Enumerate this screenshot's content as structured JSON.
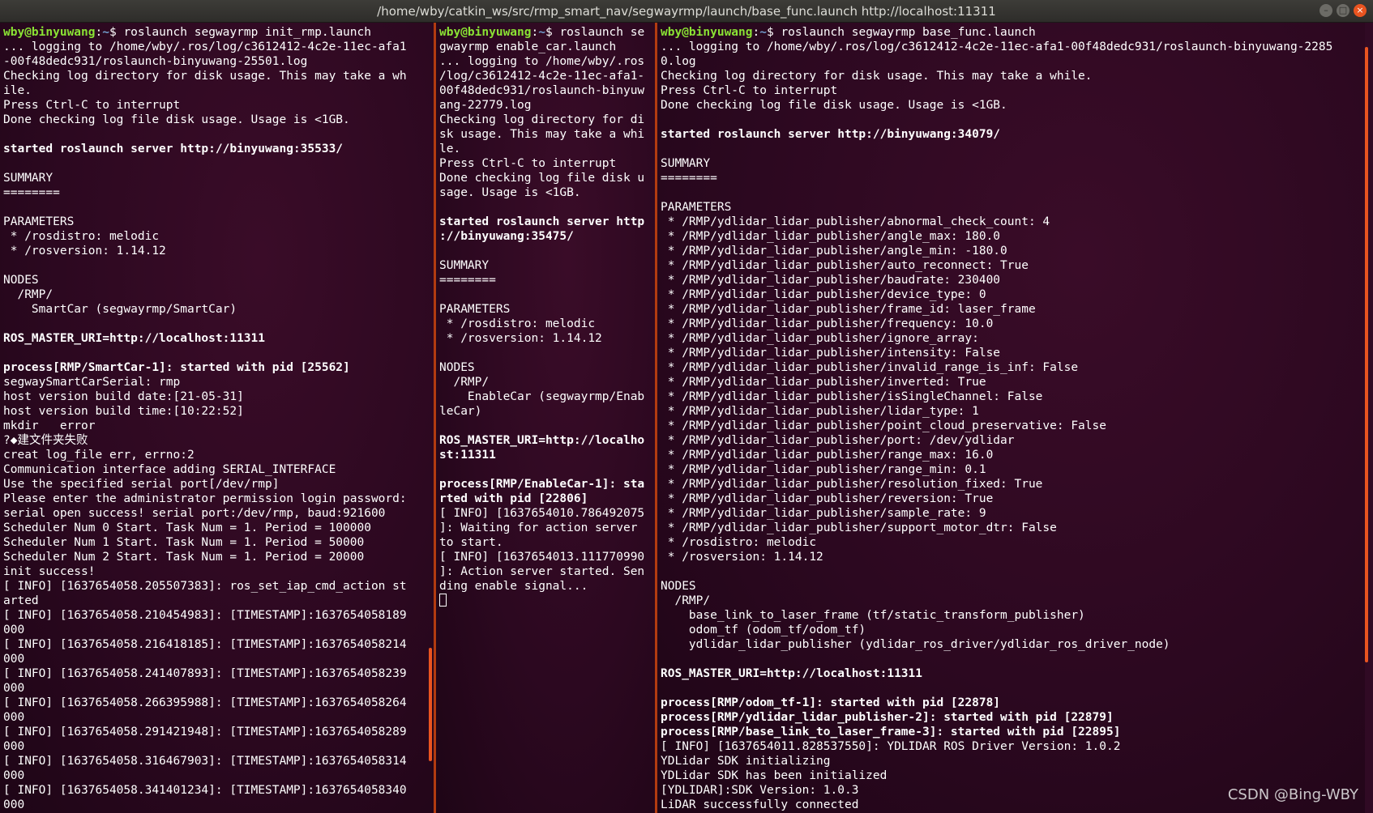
{
  "window": {
    "title": "/home/wby/catkin_ws/src/rmp_smart_nav/segwayrmp/launch/base_func.launch http://localhost:11311",
    "controls": [
      "–",
      "□",
      "×"
    ]
  },
  "colors": {
    "background": "#300a24",
    "prompt_user": "#8ae234",
    "prompt_path": "#729fcf",
    "separator": "#b23b10",
    "scrollbar": "#e95420"
  },
  "watermark": "CSDN @Bing-WBY",
  "panes": {
    "left": {
      "prompt": {
        "user": "wby@binyuwang",
        "sep": ":",
        "path": "~",
        "sym": "$ ",
        "cmd": "roslaunch segwayrmp init_rmp.launch"
      },
      "lines": [
        {
          "t": "... logging to /home/wby/.ros/log/c3612412-4c2e-11ec-afa1"
        },
        {
          "t": "-00f48dedc931/roslaunch-binyuwang-25501.log"
        },
        {
          "t": "Checking log directory for disk usage. This may take a wh"
        },
        {
          "t": "ile."
        },
        {
          "t": "Press Ctrl-C to interrupt"
        },
        {
          "t": "Done checking log file disk usage. Usage is <1GB."
        },
        {
          "t": ""
        },
        {
          "t": "started roslaunch server http://binyuwang:35533/",
          "b": true
        },
        {
          "t": ""
        },
        {
          "t": "SUMMARY"
        },
        {
          "t": "========"
        },
        {
          "t": ""
        },
        {
          "t": "PARAMETERS"
        },
        {
          "t": " * /rosdistro: melodic"
        },
        {
          "t": " * /rosversion: 1.14.12"
        },
        {
          "t": ""
        },
        {
          "t": "NODES"
        },
        {
          "t": "  /RMP/"
        },
        {
          "t": "    SmartCar (segwayrmp/SmartCar)"
        },
        {
          "t": ""
        },
        {
          "t": "ROS_MASTER_URI=http://localhost:11311",
          "b": true
        },
        {
          "t": ""
        },
        {
          "t": "process[RMP/SmartCar-1]: started with pid [25562]",
          "b": true
        },
        {
          "t": "segwaySmartCarSerial: rmp"
        },
        {
          "t": "host version build date:[21-05-31]"
        },
        {
          "t": "host version build time:[10:22:52]"
        },
        {
          "t": "mkdir   error"
        },
        {
          "t": "?◆建文件夹失败"
        },
        {
          "t": "creat log_file err, errno:2"
        },
        {
          "t": "Communication interface adding SERIAL_INTERFACE"
        },
        {
          "t": "Use the specified serial port[/dev/rmp]"
        },
        {
          "t": "Please enter the administrator permission login password:"
        },
        {
          "t": "serial open success! serial port:/dev/rmp, baud:921600"
        },
        {
          "t": "Scheduler Num 0 Start. Task Num = 1. Period = 100000"
        },
        {
          "t": "Scheduler Num 1 Start. Task Num = 1. Period = 50000"
        },
        {
          "t": "Scheduler Num 2 Start. Task Num = 1. Period = 20000"
        },
        {
          "t": "init success!"
        },
        {
          "t": "[ INFO] [1637654058.205507383]: ros_set_iap_cmd_action st"
        },
        {
          "t": "arted"
        },
        {
          "t": "[ INFO] [1637654058.210454983]: [TIMESTAMP]:1637654058189"
        },
        {
          "t": "000"
        },
        {
          "t": "[ INFO] [1637654058.216418185]: [TIMESTAMP]:1637654058214"
        },
        {
          "t": "000"
        },
        {
          "t": "[ INFO] [1637654058.241407893]: [TIMESTAMP]:1637654058239"
        },
        {
          "t": "000"
        },
        {
          "t": "[ INFO] [1637654058.266395988]: [TIMESTAMP]:1637654058264"
        },
        {
          "t": "000"
        },
        {
          "t": "[ INFO] [1637654058.291421948]: [TIMESTAMP]:1637654058289"
        },
        {
          "t": "000"
        },
        {
          "t": "[ INFO] [1637654058.316467903]: [TIMESTAMP]:1637654058314"
        },
        {
          "t": "000"
        },
        {
          "t": "[ INFO] [1637654058.341401234]: [TIMESTAMP]:1637654058340"
        },
        {
          "t": "000"
        }
      ]
    },
    "middle": {
      "prompt": {
        "user": "wby@binyuwang",
        "sep": ":",
        "path": "~",
        "sym": "$ ",
        "cmd": "roslaunch se"
      },
      "lines": [
        {
          "t": "gwayrmp enable_car.launch"
        },
        {
          "t": "... logging to /home/wby/.ros"
        },
        {
          "t": "/log/c3612412-4c2e-11ec-afa1-"
        },
        {
          "t": "00f48dedc931/roslaunch-binyuw"
        },
        {
          "t": "ang-22779.log"
        },
        {
          "t": "Checking log directory for di"
        },
        {
          "t": "sk usage. This may take a whi"
        },
        {
          "t": "le."
        },
        {
          "t": "Press Ctrl-C to interrupt"
        },
        {
          "t": "Done checking log file disk u"
        },
        {
          "t": "sage. Usage is <1GB."
        },
        {
          "t": ""
        },
        {
          "t": "started roslaunch server http",
          "b": true
        },
        {
          "t": "://binyuwang:35475/",
          "b": true
        },
        {
          "t": ""
        },
        {
          "t": "SUMMARY"
        },
        {
          "t": "========"
        },
        {
          "t": ""
        },
        {
          "t": "PARAMETERS"
        },
        {
          "t": " * /rosdistro: melodic"
        },
        {
          "t": " * /rosversion: 1.14.12"
        },
        {
          "t": ""
        },
        {
          "t": "NODES"
        },
        {
          "t": "  /RMP/"
        },
        {
          "t": "    EnableCar (segwayrmp/Enab"
        },
        {
          "t": "leCar)"
        },
        {
          "t": ""
        },
        {
          "t": "ROS_MASTER_URI=http://localho",
          "b": true
        },
        {
          "t": "st:11311",
          "b": true
        },
        {
          "t": ""
        },
        {
          "t": "process[RMP/EnableCar-1]: sta",
          "b": true
        },
        {
          "t": "rted with pid [22806]",
          "b": true
        },
        {
          "t": "[ INFO] [1637654010.786492075"
        },
        {
          "t": "]: Waiting for action server"
        },
        {
          "t": "to start."
        },
        {
          "t": "[ INFO] [1637654013.111770990"
        },
        {
          "t": "]: Action server started. Sen"
        },
        {
          "t": "ding enable signal..."
        }
      ]
    },
    "right": {
      "prompt": {
        "user": "wby@binyuwang",
        "sep": ":",
        "path": "~",
        "sym": "$ ",
        "cmd": "roslaunch segwayrmp base_func.launch"
      },
      "lines": [
        {
          "t": "... logging to /home/wby/.ros/log/c3612412-4c2e-11ec-afa1-00f48dedc931/roslaunch-binyuwang-2285"
        },
        {
          "t": "0.log"
        },
        {
          "t": "Checking log directory for disk usage. This may take a while."
        },
        {
          "t": "Press Ctrl-C to interrupt"
        },
        {
          "t": "Done checking log file disk usage. Usage is <1GB."
        },
        {
          "t": ""
        },
        {
          "t": "started roslaunch server http://binyuwang:34079/",
          "b": true
        },
        {
          "t": ""
        },
        {
          "t": "SUMMARY"
        },
        {
          "t": "========"
        },
        {
          "t": ""
        },
        {
          "t": "PARAMETERS"
        },
        {
          "t": " * /RMP/ydlidar_lidar_publisher/abnormal_check_count: 4"
        },
        {
          "t": " * /RMP/ydlidar_lidar_publisher/angle_max: 180.0"
        },
        {
          "t": " * /RMP/ydlidar_lidar_publisher/angle_min: -180.0"
        },
        {
          "t": " * /RMP/ydlidar_lidar_publisher/auto_reconnect: True"
        },
        {
          "t": " * /RMP/ydlidar_lidar_publisher/baudrate: 230400"
        },
        {
          "t": " * /RMP/ydlidar_lidar_publisher/device_type: 0"
        },
        {
          "t": " * /RMP/ydlidar_lidar_publisher/frame_id: laser_frame"
        },
        {
          "t": " * /RMP/ydlidar_lidar_publisher/frequency: 10.0"
        },
        {
          "t": " * /RMP/ydlidar_lidar_publisher/ignore_array:"
        },
        {
          "t": " * /RMP/ydlidar_lidar_publisher/intensity: False"
        },
        {
          "t": " * /RMP/ydlidar_lidar_publisher/invalid_range_is_inf: False"
        },
        {
          "t": " * /RMP/ydlidar_lidar_publisher/inverted: True"
        },
        {
          "t": " * /RMP/ydlidar_lidar_publisher/isSingleChannel: False"
        },
        {
          "t": " * /RMP/ydlidar_lidar_publisher/lidar_type: 1"
        },
        {
          "t": " * /RMP/ydlidar_lidar_publisher/point_cloud_preservative: False"
        },
        {
          "t": " * /RMP/ydlidar_lidar_publisher/port: /dev/ydlidar"
        },
        {
          "t": " * /RMP/ydlidar_lidar_publisher/range_max: 16.0"
        },
        {
          "t": " * /RMP/ydlidar_lidar_publisher/range_min: 0.1"
        },
        {
          "t": " * /RMP/ydlidar_lidar_publisher/resolution_fixed: True"
        },
        {
          "t": " * /RMP/ydlidar_lidar_publisher/reversion: True"
        },
        {
          "t": " * /RMP/ydlidar_lidar_publisher/sample_rate: 9"
        },
        {
          "t": " * /RMP/ydlidar_lidar_publisher/support_motor_dtr: False"
        },
        {
          "t": " * /rosdistro: melodic"
        },
        {
          "t": " * /rosversion: 1.14.12"
        },
        {
          "t": ""
        },
        {
          "t": "NODES"
        },
        {
          "t": "  /RMP/"
        },
        {
          "t": "    base_link_to_laser_frame (tf/static_transform_publisher)"
        },
        {
          "t": "    odom_tf (odom_tf/odom_tf)"
        },
        {
          "t": "    ydlidar_lidar_publisher (ydlidar_ros_driver/ydlidar_ros_driver_node)"
        },
        {
          "t": ""
        },
        {
          "t": "ROS_MASTER_URI=http://localhost:11311",
          "b": true
        },
        {
          "t": ""
        },
        {
          "t": "process[RMP/odom_tf-1]: started with pid [22878]",
          "b": true
        },
        {
          "t": "process[RMP/ydlidar_lidar_publisher-2]: started with pid [22879]",
          "b": true
        },
        {
          "t": "process[RMP/base_link_to_laser_frame-3]: started with pid [22895]",
          "b": true
        },
        {
          "t": "[ INFO] [1637654011.828537550]: YDLIDAR ROS Driver Version: 1.0.2"
        },
        {
          "t": "YDLidar SDK initializing"
        },
        {
          "t": "YDLidar SDK has been initialized"
        },
        {
          "t": "[YDLIDAR]:SDK Version: 1.0.3"
        },
        {
          "t": "LiDAR successfully connected"
        }
      ]
    }
  }
}
